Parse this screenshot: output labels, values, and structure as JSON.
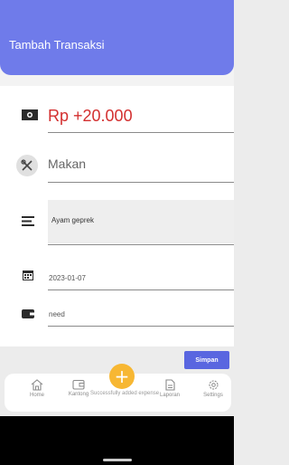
{
  "header": {
    "title": "Tambah Transaksi"
  },
  "form": {
    "amount": "Rp +20.000",
    "category": "Makan",
    "note": "Ayam geprek",
    "date": "2023-01-07",
    "wallet": "need",
    "save_label": "Simpan"
  },
  "fab": {
    "label": "+"
  },
  "toast": {
    "message": "Successfully added expense"
  },
  "bottom_nav": {
    "items": [
      {
        "label": "Home",
        "icon": "home-icon"
      },
      {
        "label": "Kantong",
        "icon": "wallet-icon"
      },
      {
        "label": "Laporan",
        "icon": "report-icon"
      },
      {
        "label": "Settings",
        "icon": "gear-icon"
      }
    ]
  },
  "colors": {
    "accent": "#6f7bea",
    "button": "#5966e0",
    "amount": "#d32f2f",
    "fab": "#f7b733"
  }
}
